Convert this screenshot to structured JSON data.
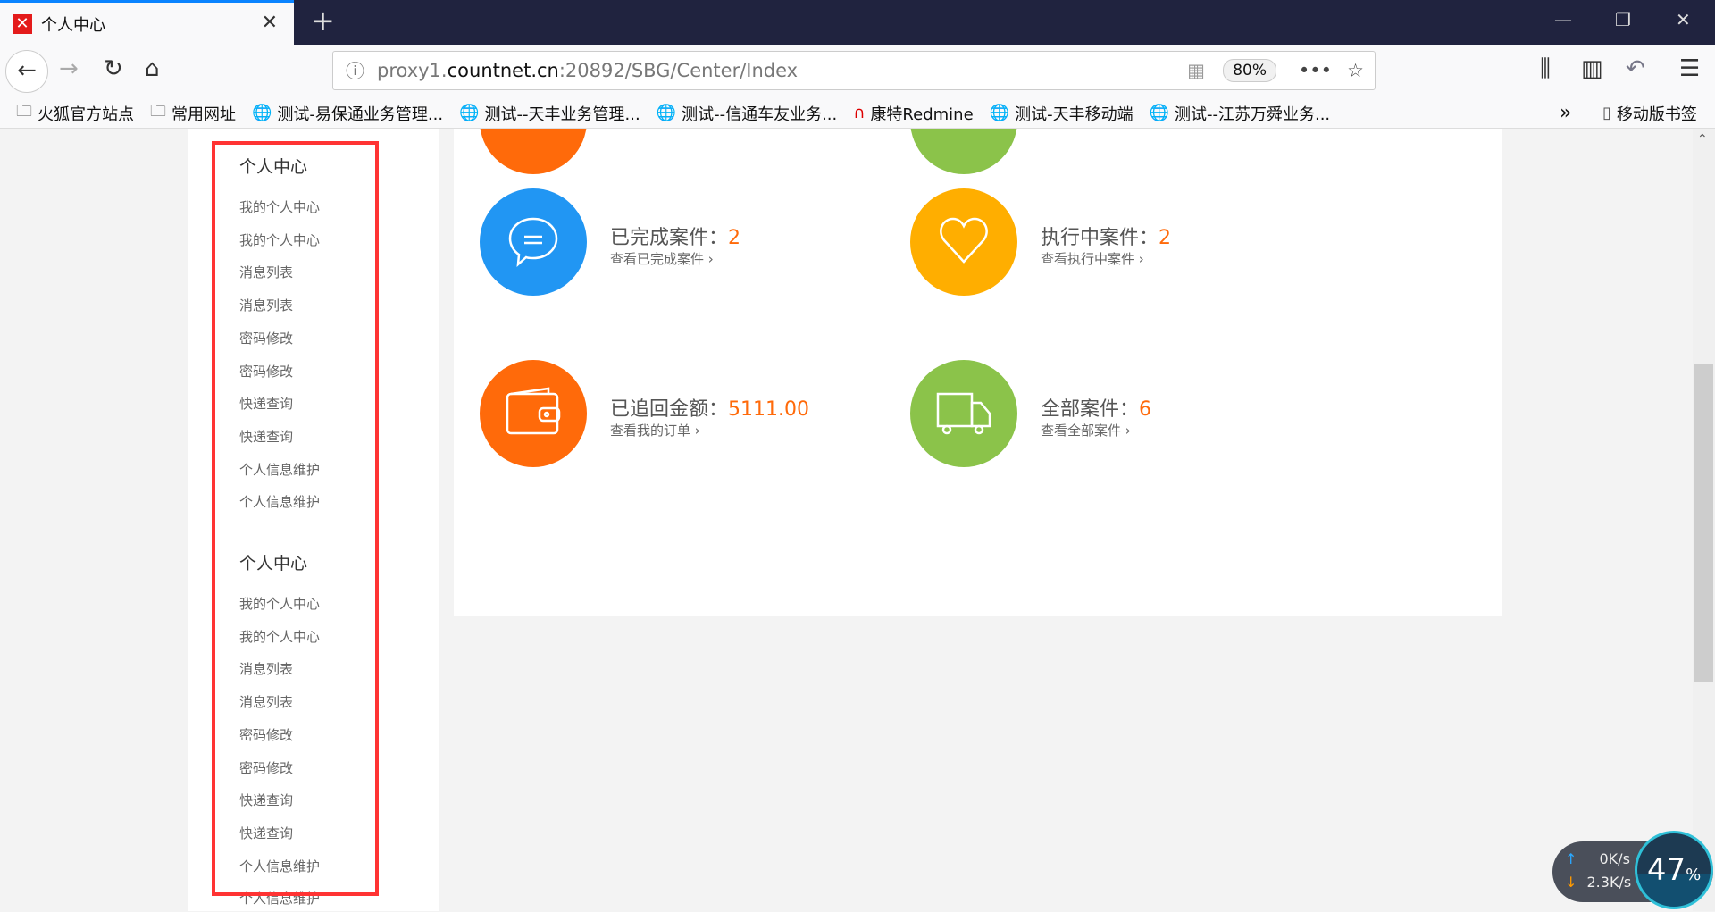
{
  "browser": {
    "tab_title": "个人中心",
    "url_host_pre": "proxy1.",
    "url_host": "countnet.cn",
    "url_rest": ":20892/SBG/Center/Index",
    "zoom": "80%"
  },
  "bookmarks": [
    "火狐官方站点",
    "常用网址",
    "测试-易保通业务管理...",
    "测试--天丰业务管理...",
    "测试--信通车友业务...",
    "康特Redmine",
    "测试-天丰移动端",
    "测试--江苏万舜业务..."
  ],
  "bookmarks_mobile": "移动版书签",
  "sidebar": {
    "groups": [
      {
        "title": "个人中心",
        "items": [
          "我的个人中心",
          "我的个人中心",
          "消息列表",
          "消息列表",
          "密码修改",
          "密码修改",
          "快递查询",
          "快递查询",
          "个人信息维护",
          "个人信息维护"
        ]
      },
      {
        "title": "个人中心",
        "items": [
          "我的个人中心",
          "我的个人中心",
          "消息列表",
          "消息列表",
          "密码修改",
          "密码修改",
          "快递查询",
          "快递查询",
          "个人信息维护",
          "个人信息维护"
        ]
      }
    ]
  },
  "stats": [
    {
      "label": "已完成案件：",
      "value": "2",
      "link": "查看已完成案件 ›",
      "color": "#2196f3",
      "icon": "chat-icon"
    },
    {
      "label": "执行中案件：",
      "value": "2",
      "link": "查看执行中案件 ›",
      "color": "#ffae00",
      "icon": "heart-icon"
    },
    {
      "label": "已追回金额：",
      "value": "5111.00",
      "link": "查看我的订单 ›",
      "color": "#ff6a0a",
      "icon": "wallet-icon"
    },
    {
      "label": "全部案件：",
      "value": "6",
      "link": "查看全部案件 ›",
      "color": "#8bc34a",
      "icon": "truck-icon"
    }
  ],
  "network": {
    "up": "0K/s",
    "down": "2.3K/s",
    "percent": "47",
    "percent_sign": "%"
  }
}
